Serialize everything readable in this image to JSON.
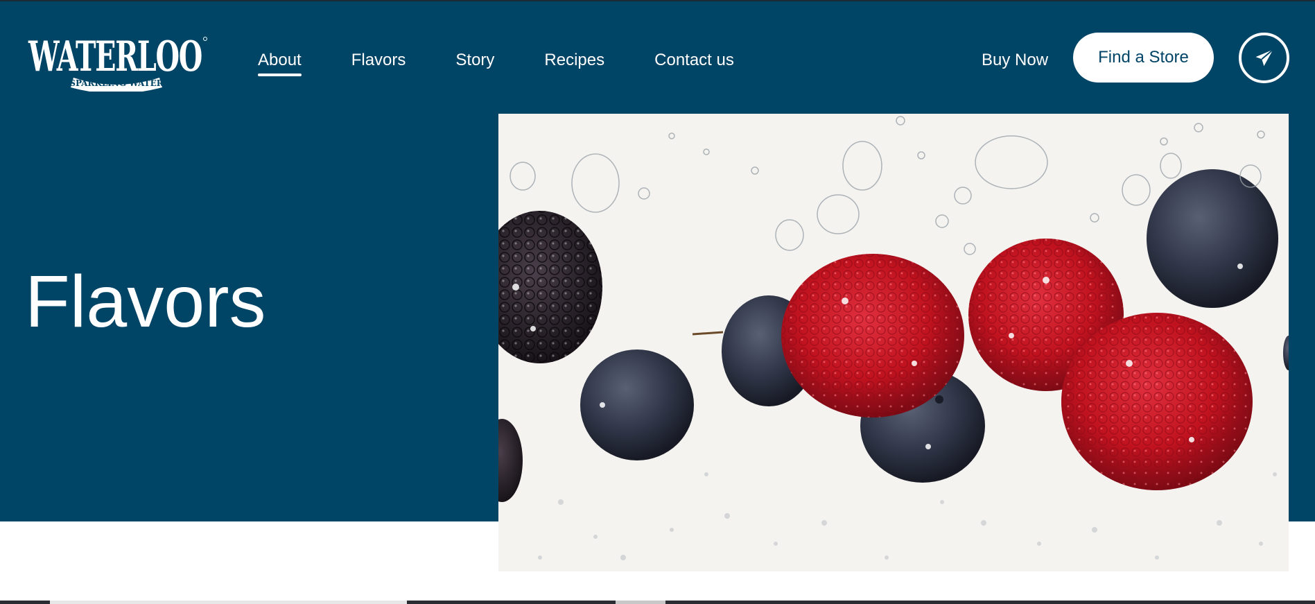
{
  "brand": {
    "logo_name": "WATERLOO",
    "logo_tagline": "SPARKLING WATER",
    "colors": {
      "navy": "#004466",
      "white": "#ffffff",
      "raspberry": "#c1121f",
      "blueberry": "#2f3547"
    }
  },
  "nav": {
    "items": [
      {
        "label": "About",
        "active": true
      },
      {
        "label": "Flavors",
        "active": false
      },
      {
        "label": "Story",
        "active": false
      },
      {
        "label": "Recipes",
        "active": false
      },
      {
        "label": "Contact us",
        "active": false
      }
    ]
  },
  "header_actions": {
    "buy_now": "Buy Now",
    "find_store": "Find a Store",
    "send_icon": "paper-plane-icon"
  },
  "hero": {
    "title": "Flavors",
    "image_subject": "raspberries-and-blueberries-in-sparkling-water-image"
  }
}
